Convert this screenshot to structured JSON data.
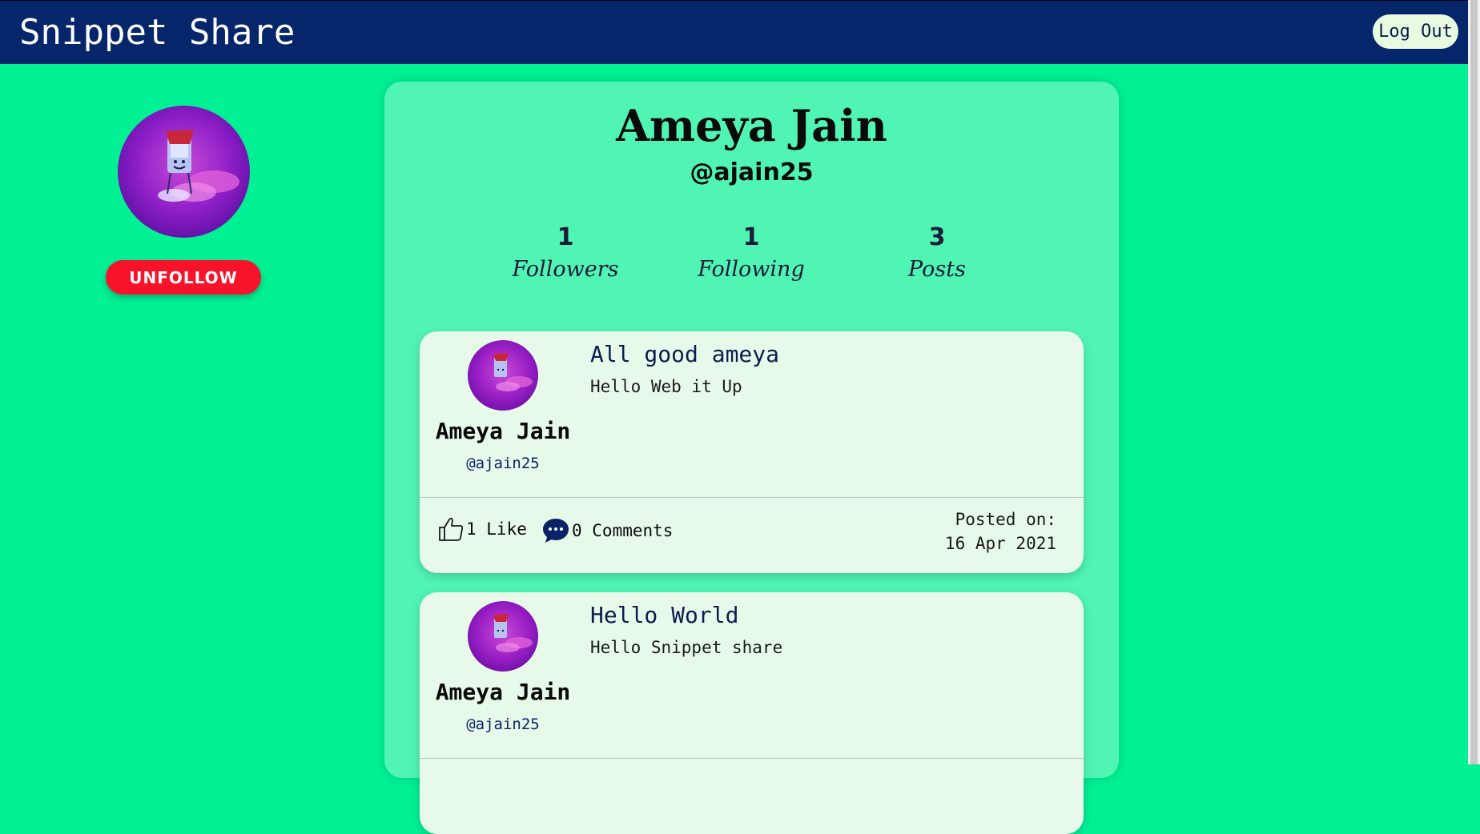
{
  "navbar": {
    "brand": "Snippet Share",
    "logout_label": "Log Out"
  },
  "sidebar": {
    "avatar_icon": "profile-photo",
    "follow_button_label": "UNFOLLOW",
    "follow_button_color": "#f7142b"
  },
  "profile": {
    "name": "Ameya Jain",
    "handle": "@ajain25",
    "stats": [
      {
        "count": "1",
        "label": "Followers"
      },
      {
        "count": "1",
        "label": "Following"
      },
      {
        "count": "3",
        "label": "Posts"
      }
    ]
  },
  "posts": [
    {
      "author": "Ameya Jain",
      "handle": "@ajain25",
      "title": "All good ameya",
      "body": "Hello Web it Up",
      "likes": "1 Like",
      "comments": "0 Comments",
      "posted_label": "Posted on:",
      "posted_date": "16 Apr 2021"
    },
    {
      "author": "Ameya Jain",
      "handle": "@ajain25",
      "title": "Hello World",
      "body": "Hello Snippet share",
      "likes": "",
      "comments": "",
      "posted_label": "",
      "posted_date": ""
    }
  ],
  "colors": {
    "page_background": "#00f194",
    "navbar": "#05266a",
    "profile_card": "#50f5b3",
    "post_card": "#e7faea",
    "accent_text": "#0b2366"
  }
}
